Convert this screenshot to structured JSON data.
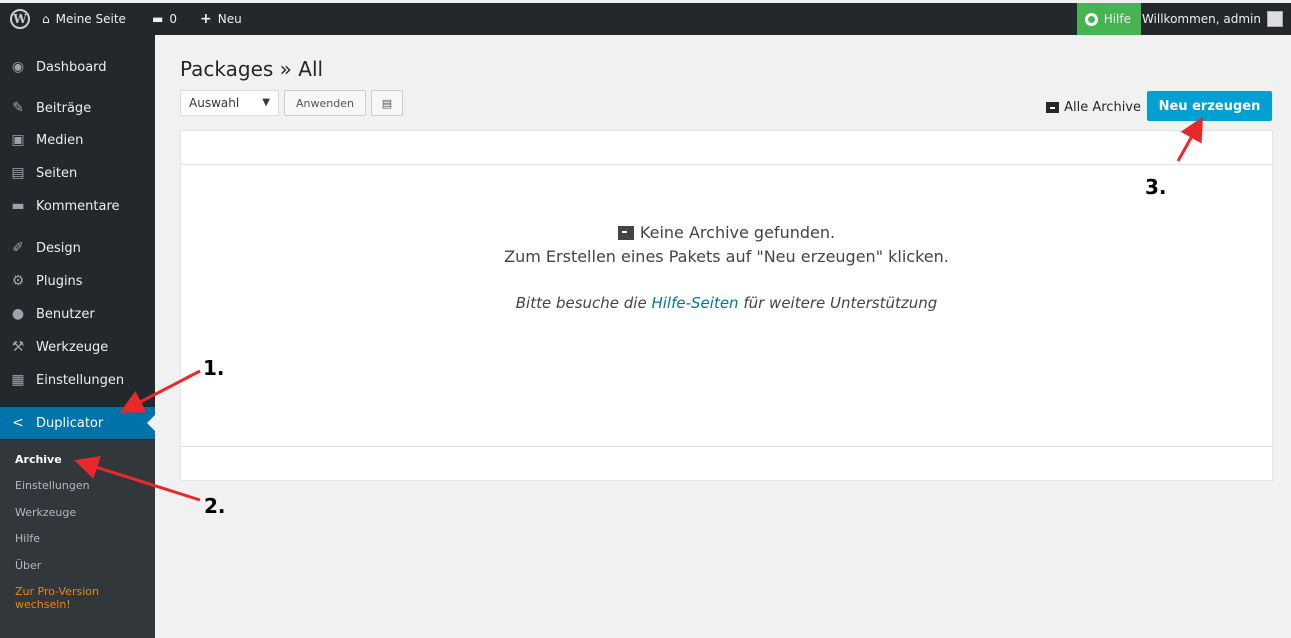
{
  "adminbar": {
    "site_name": "Meine Seite",
    "comments_count": "0",
    "new_label": "Neu",
    "help_label": "Hilfe",
    "account_label": "Willkommen, admin"
  },
  "sidebar": {
    "items": [
      {
        "label": "Dashboard",
        "icon": "dashboard-icon"
      },
      {
        "label": "Beiträge",
        "icon": "pin-icon"
      },
      {
        "label": "Medien",
        "icon": "media-icon"
      },
      {
        "label": "Seiten",
        "icon": "pages-icon"
      },
      {
        "label": "Kommentare",
        "icon": "comment-icon"
      },
      {
        "label": "Design",
        "icon": "brush-icon"
      },
      {
        "label": "Plugins",
        "icon": "plugin-icon"
      },
      {
        "label": "Benutzer",
        "icon": "user-icon"
      },
      {
        "label": "Werkzeuge",
        "icon": "wrench-icon"
      },
      {
        "label": "Einstellungen",
        "icon": "settings-icon"
      },
      {
        "label": "Duplicator",
        "icon": "share-icon"
      }
    ],
    "submenu": [
      "Archive",
      "Einstellungen",
      "Werkzeuge",
      "Hilfe",
      "Über"
    ],
    "pro_line1": "Zur Pro-Version",
    "pro_line2": "wechseln!"
  },
  "main": {
    "title": "Packages » All",
    "bulk_select": "Auswahl",
    "apply_label": "Anwenden",
    "all_archives_label": "Alle Archive",
    "new_button_label": "Neu erzeugen",
    "empty_title": "Keine Archive gefunden.",
    "empty_subtitle": "Zum Erstellen eines Pakets auf \"Neu erzeugen\" klicken.",
    "help_prefix": "Bitte besuche die ",
    "help_link": "Hilfe-Seiten",
    "help_suffix": " für weitere Unterstützung"
  },
  "annotations": {
    "label1": "1.",
    "label2": "2.",
    "label3": "3.",
    "arrow_color": "#e8282b"
  }
}
